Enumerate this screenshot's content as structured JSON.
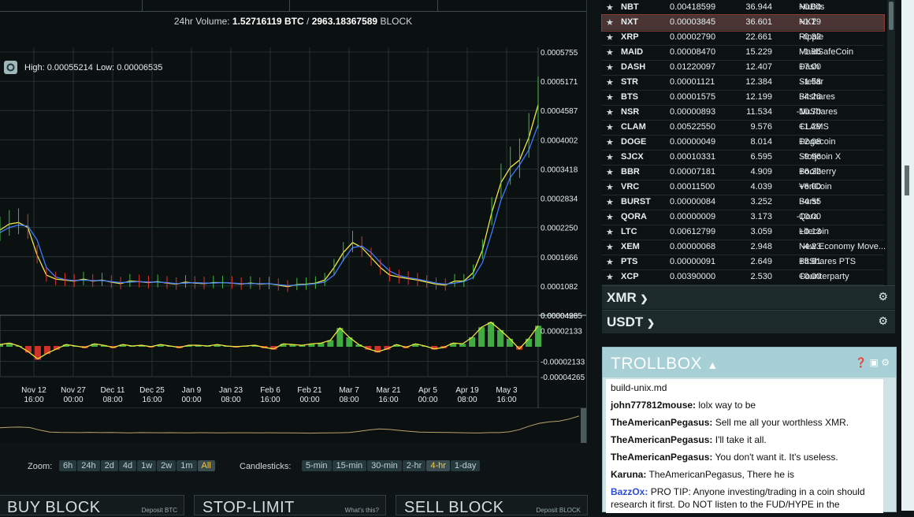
{
  "header": {
    "volume_label": "24hr Volume:",
    "volume_btc": "1.52716119 BTC",
    "volume_sep": "/",
    "volume_block": "2963.18367589",
    "volume_unit": "BLOCK"
  },
  "chart": {
    "high_label": "High: 0.00055214",
    "low_label": "Low: 0.00006535",
    "colors": {
      "ema_fast": "#f0e640",
      "ema_slow": "#3d7cff",
      "candle_up": "#4fd24f",
      "candle_down": "#ff3b2f",
      "grid": "#2b3a3c",
      "axis_text": "#e6eeef"
    }
  },
  "chart_data": [
    {
      "type": "line",
      "title": "",
      "y_ticks": [
        "0.0005755",
        "0.0005171",
        "0.0004587",
        "0.0004002",
        "0.0003418",
        "0.0002834",
        "0.0002250",
        "0.0001666",
        "0.0001082",
        "0.0000498"
      ],
      "ylim": [
        4.98e-05,
        0.0005755
      ],
      "x_ticks": [
        {
          "date": "Nov 12",
          "time": "16:00"
        },
        {
          "date": "Nov 27",
          "time": "00:00"
        },
        {
          "date": "Dec 11",
          "time": "08:00"
        },
        {
          "date": "Dec 25",
          "time": "16:00"
        },
        {
          "date": "Jan 9",
          "time": "00:00"
        },
        {
          "date": "Jan 23",
          "time": "08:00"
        },
        {
          "date": "Feb 6",
          "time": "16:00"
        },
        {
          "date": "Feb 21",
          "time": "00:00"
        },
        {
          "date": "Mar 7",
          "time": "08:00"
        },
        {
          "date": "Mar 21",
          "time": "16:00"
        },
        {
          "date": "Apr 5",
          "time": "00:00"
        },
        {
          "date": "Apr 19",
          "time": "08:00"
        },
        {
          "date": "May 3",
          "time": "16:00"
        }
      ],
      "series": [
        {
          "values": [
            0.00022,
            0.000232,
            0.000235,
            0.000225,
            0.00017,
            0.00013,
            0.000122,
            0.00012,
            0.000118,
            0.000122,
            0.000118,
            0.00012,
            0.000116,
            0.000113,
            0.000118,
            0.000117,
            0.000115,
            0.000117,
            0.000114,
            0.000112,
            0.000116,
            0.000114,
            0.000113,
            0.000115,
            0.000115,
            0.000114,
            0.000112,
            0.000114,
            0.000112,
            0.000113,
            0.00011,
            0.000107,
            0.000111,
            0.000112,
            0.000114,
            0.00012,
            0.000145,
            0.000175,
            0.000195,
            0.000185,
            0.000165,
            0.000145,
            0.00013,
            0.000126,
            0.000123,
            0.00012,
            0.000116,
            0.000112,
            0.00011,
            0.000118,
            0.000118,
            0.000135,
            0.00018,
            0.000255,
            0.000315,
            0.000345,
            0.00036,
            0.000405,
            0.00047
          ]
        },
        {
          "values": [
            0.000215,
            0.000225,
            0.00023,
            0.000228,
            0.0002,
            0.000145,
            0.000126,
            0.000121,
            0.000119,
            0.00012,
            0.000119,
            0.000119,
            0.000117,
            0.000115,
            0.000116,
            0.000117,
            0.000116,
            0.000116,
            0.000115,
            0.000113,
            0.000114,
            0.000115,
            0.000114,
            0.000114,
            0.000115,
            0.000114,
            0.000113,
            0.000113,
            0.000113,
            0.000113,
            0.000111,
            0.000109,
            0.00011,
            0.000111,
            0.000113,
            0.000116,
            0.00013,
            0.00016,
            0.000185,
            0.000188,
            0.000175,
            0.000155,
            0.000138,
            0.000129,
            0.000125,
            0.000122,
            0.000118,
            0.000114,
            0.000112,
            0.000114,
            0.000117,
            0.000125,
            0.000155,
            0.000215,
            0.00028,
            0.000325,
            0.00035,
            0.00038,
            0.00043
          ]
        }
      ]
    },
    {
      "type": "line",
      "title": "",
      "y_ticks": [
        "0.00004265",
        "0.00002133",
        "-0.00002133",
        "-0.00004265"
      ],
      "ylim": [
        -4.265e-05,
        4.265e-05
      ],
      "series": [
        {
          "values": [
            2e-06,
            4e-06,
            0.0,
            -8e-06,
            -1.8e-05,
            -1e-05,
            -4e-06,
            2e-06,
            0.0,
            -2e-06,
            3e-06,
            1e-06,
            -2e-06,
            2e-06,
            0.0,
            1e-06,
            -1e-06,
            2e-06,
            0.0,
            -2e-06,
            1e-06,
            1e-06,
            0.0,
            2e-06,
            0.0,
            -1e-06,
            0.0,
            1e-06,
            -2e-06,
            -4e-06,
            3e-06,
            2e-06,
            1e-06,
            3e-06,
            4e-06,
            8e-06,
            2.5e-05,
            1.2e-05,
            2e-06,
            -4e-06,
            -8e-06,
            -4e-06,
            2e-06,
            -2e-06,
            3e-06,
            0.0,
            -4e-06,
            -2e-06,
            4e-06,
            3e-06,
            1.2e-05,
            2.6e-05,
            3.3e-05,
            2.2e-05,
            1e-05,
            -4e-06,
            1e-05,
            2.8e-05
          ]
        }
      ]
    }
  ],
  "zoom": {
    "label": "Zoom:",
    "options": [
      "6h",
      "24h",
      "2d",
      "4d",
      "1w",
      "2w",
      "1m",
      "All"
    ],
    "active": "All"
  },
  "candles": {
    "label": "Candlesticks:",
    "options": [
      "5-min",
      "15-min",
      "30-min",
      "2-hr",
      "4-hr",
      "1-day"
    ],
    "active": "4-hr"
  },
  "bottom_boxes": [
    {
      "title": "BUY BLOCK",
      "sub": "Deposit BTC"
    },
    {
      "title": "STOP-LIMIT",
      "sub": "What's this?"
    },
    {
      "title": "SELL BLOCK",
      "sub": "Deposit BLOCK"
    }
  ],
  "markets": [
    {
      "sym": "NBT",
      "price": "0.00418599",
      "vol": "36.944",
      "chg": "+0.00",
      "name": "NuBits"
    },
    {
      "sym": "NXT",
      "price": "0.00003845",
      "vol": "36.601",
      "chg": "+1.29",
      "name": "NXT",
      "selected": true
    },
    {
      "sym": "XRP",
      "price": "0.00002790",
      "vol": "22.661",
      "chg": "-0.32",
      "name": "Ripple"
    },
    {
      "sym": "MAID",
      "price": "0.00008470",
      "vol": "15.229",
      "chg": "-1.96",
      "name": "MaidSafeCoin"
    },
    {
      "sym": "DASH",
      "price": "0.01220097",
      "vol": "12.407",
      "chg": "+7.00",
      "name": "Dash"
    },
    {
      "sym": "STR",
      "price": "0.00001121",
      "vol": "12.384",
      "chg": "-1.58",
      "name": "Stellar"
    },
    {
      "sym": "BTS",
      "price": "0.00001575",
      "vol": "12.199",
      "chg": "-4.26",
      "name": "Bitshares"
    },
    {
      "sym": "NSR",
      "price": "0.00000893",
      "vol": "11.534",
      "chg": "-10.70",
      "name": "NuShares"
    },
    {
      "sym": "CLAM",
      "price": "0.00522550",
      "vol": "9.576",
      "chg": "+1.29",
      "name": "CLAMS"
    },
    {
      "sym": "DOGE",
      "price": "0.00000049",
      "vol": "8.014",
      "chg": "+2.08",
      "name": "Dogecoin"
    },
    {
      "sym": "SJCX",
      "price": "0.00010331",
      "vol": "6.595",
      "chg": "-9.96",
      "name": "Storjcoin X"
    },
    {
      "sym": "BBR",
      "price": "0.00007181",
      "vol": "4.909",
      "chg": "+6.32",
      "name": "Boolberry"
    },
    {
      "sym": "VRC",
      "price": "0.00011500",
      "vol": "4.039",
      "chg": "+6.00",
      "name": "VeriCoin"
    },
    {
      "sym": "BURST",
      "price": "0.00000084",
      "vol": "3.252",
      "chg": "-4.55",
      "name": "Burst"
    },
    {
      "sym": "QORA",
      "price": "0.00000009",
      "vol": "3.173",
      "chg": "-10.00",
      "name": "Qora"
    },
    {
      "sym": "LTC",
      "price": "0.00612799",
      "vol": "3.059",
      "chg": "+0.13",
      "name": "Litecoin"
    },
    {
      "sym": "XEM",
      "price": "0.00000068",
      "vol": "2.948",
      "chg": "-4.23",
      "name": "New Economy Move..."
    },
    {
      "sym": "PTS",
      "price": "0.00000091",
      "vol": "2.649",
      "chg": "+5.81",
      "name": "BitShares PTS"
    },
    {
      "sym": "XCP",
      "price": "0.00390000",
      "vol": "2.530",
      "chg": "+0.00",
      "name": "Counterparty"
    }
  ],
  "sections": [
    {
      "label": "XMR",
      "icon": "gear-icon"
    },
    {
      "label": "USDT",
      "icon": "gear-icon"
    }
  ],
  "trollbox": {
    "title": "TROLLBOX",
    "messages": [
      {
        "user": "",
        "text": "build-unix.md"
      },
      {
        "user": "john777812mouse:",
        "text": "lolx way to be"
      },
      {
        "user": "TheAmericanPegasus:",
        "text": "Sell me all your worthless XMR."
      },
      {
        "user": "TheAmericanPegasus:",
        "text": "I'll take it all."
      },
      {
        "user": "TheAmericanPegasus:",
        "text": "You don't want it. It's useless."
      },
      {
        "user": "Karuna:",
        "text": "TheAmericanPegasus, There he is"
      },
      {
        "user": "BazzOx:",
        "text": "PRO TIP: Anyone investing/trading in a coin should research it first. Do NOT listen to the FUD/HYPE in the"
      }
    ]
  }
}
